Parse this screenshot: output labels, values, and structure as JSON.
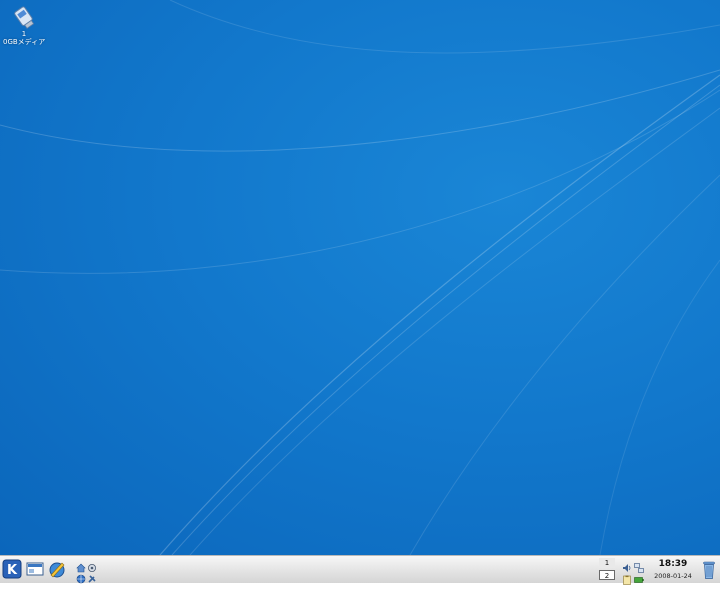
{
  "desktop": {
    "icons": [
      {
        "name": "removable-drive",
        "label_line1": "1",
        "label_line2": "0GBメディア"
      }
    ],
    "background_color": "#1278cc"
  },
  "taskbar": {
    "kmenu_icon": "kde-k-icon",
    "show_desktop_icon": "show-desktop-icon",
    "konqueror_icon": "konqueror-icon",
    "quick_launch_icons": [
      "home-folder-icon",
      "system-settings-icon",
      "web-browser-icon",
      "tools-icon"
    ],
    "pager": {
      "desktops": [
        "1",
        "2"
      ],
      "active": "2"
    },
    "tray_icons": [
      "volume-icon",
      "network-icon",
      "clipboard-icon",
      "battery-icon"
    ],
    "clock": {
      "time": "18:39",
      "date": "2008-01-24"
    },
    "trash_icon": "trash-icon"
  },
  "colors": {
    "desktop_blue": "#1278cc",
    "panel_gray": "#e2e2e2",
    "kde_blue": "#2a62b8"
  }
}
